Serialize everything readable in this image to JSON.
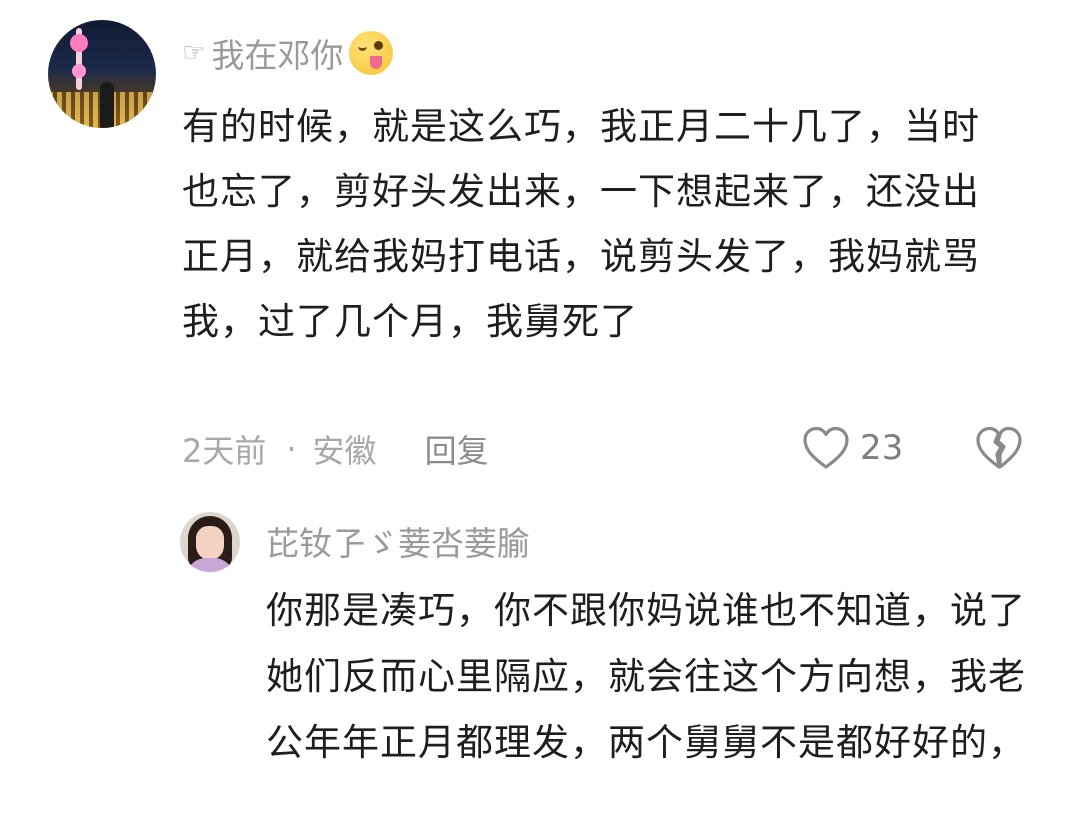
{
  "main_comment": {
    "username": "我在邓你",
    "username_prefix_icon": "pointing-hand-icon",
    "username_suffix_icon": "tongue-wink-emoji",
    "text": "有的时候，就是这么巧，我正月二十几了，当时也忘了，剪好头发出来，一下想起来了，还没出正月，就给我妈打电话，说剪头发了，我妈就骂我，过了几个月，我舅死了",
    "time": "2天前",
    "separator": "·",
    "location": "安徽",
    "reply_label": "回复",
    "like_count": "23",
    "like_icon": "heart-outline-icon",
    "dislike_icon": "broken-heart-icon"
  },
  "reply_comment": {
    "username": "芘钕孒ゞ菨呇菨腧",
    "text": "你那是凑巧，你不跟你妈说谁也不知道，说了她们反而心里隔应，就会往这个方向想，我老公年年正月都理发，两个舅舅不是都好好的，"
  }
}
